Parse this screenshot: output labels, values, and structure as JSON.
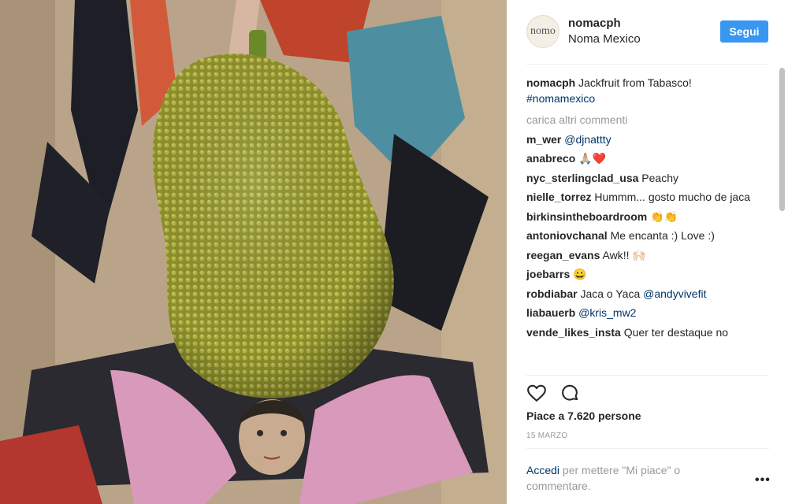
{
  "post": {
    "username": "nomacph",
    "location": "Noma Mexico",
    "avatar_text": "nomo",
    "follow_label": "Segui",
    "caption_user": "nomacph",
    "caption_text": "Jackfruit from Tabasco!",
    "caption_tag": "#nomamexico",
    "load_more": "carica altri commenti",
    "comments": [
      {
        "user": "m_wer",
        "text": "",
        "mention": "@djnattty"
      },
      {
        "user": "anabreco",
        "text": "🙏🏼❤️",
        "mention": ""
      },
      {
        "user": "nyc_sterlingclad_usa",
        "text": "Peachy",
        "mention": ""
      },
      {
        "user": "nielle_torrez",
        "text": "Hummm... gosto mucho de jaca",
        "mention": ""
      },
      {
        "user": "birkinsintheboardroom",
        "text": "👏👏",
        "mention": ""
      },
      {
        "user": "antoniovchanal",
        "text": "Me encanta :) Love :)",
        "mention": ""
      },
      {
        "user": "reegan_evans",
        "text": "Awk!! 🙌🏻",
        "mention": ""
      },
      {
        "user": "joebarrs",
        "text": "😀",
        "mention": ""
      },
      {
        "user": "robdiabar",
        "text": "Jaca o Yaca",
        "mention": "@andyvivefit"
      },
      {
        "user": "liabauerb",
        "text": "",
        "mention": "@kris_mw2"
      },
      {
        "user": "vende_likes_insta",
        "text": "Quer ter destaque no",
        "mention": ""
      }
    ],
    "likes": "Piace a 7.620 persone",
    "date": "15 MARZO",
    "login_link": "Accedi",
    "login_text": " per mettere \"Mi piace\" o commentare.",
    "more_options": "•••",
    "icons": [
      "heart-icon",
      "comment-icon",
      "more-options-icon"
    ]
  }
}
